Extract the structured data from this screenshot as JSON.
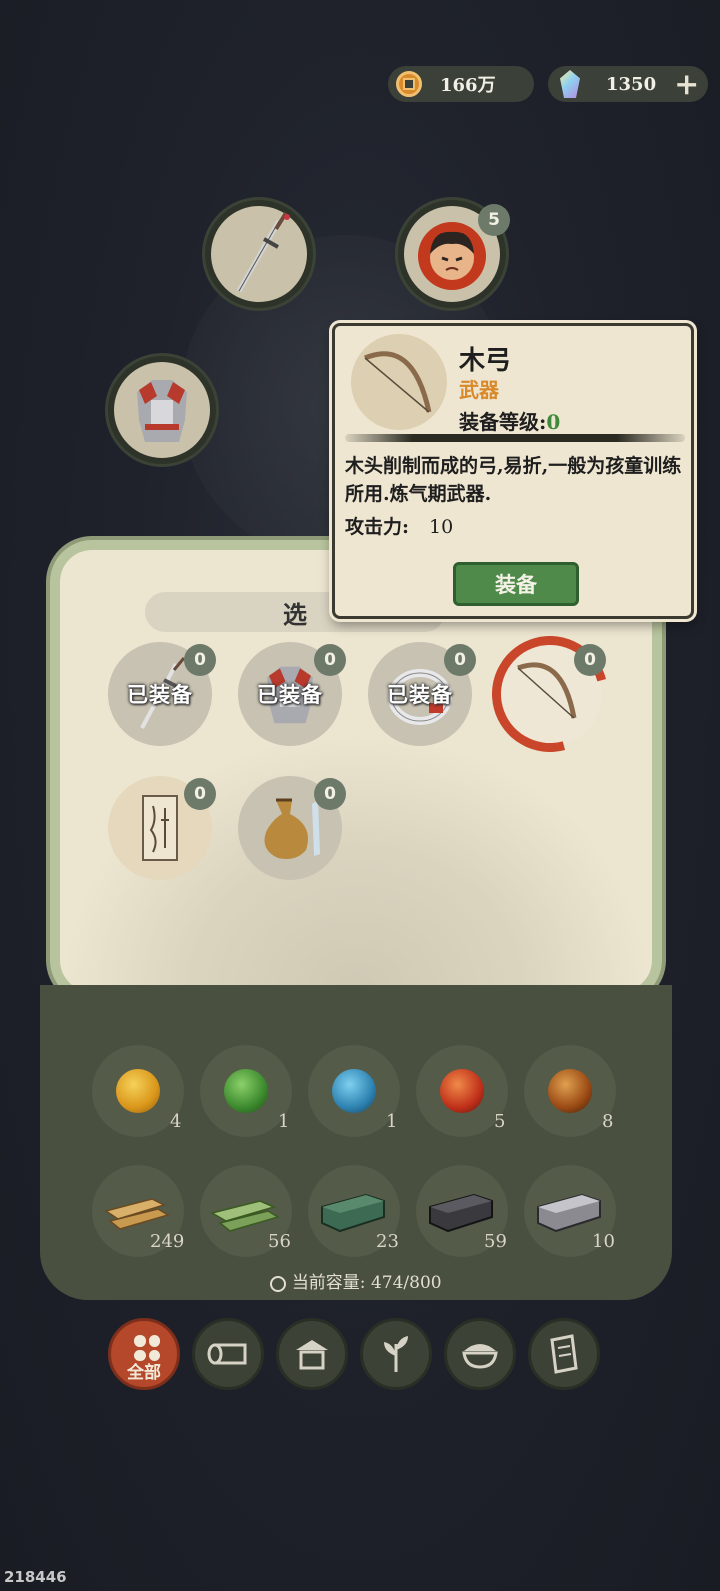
{
  "currency": {
    "coins": "166万",
    "gems": "1350",
    "add_label": "+"
  },
  "equip_slots": {
    "companion_badge": "5"
  },
  "inventory": {
    "title": "选",
    "equipped_label": "已装备",
    "items": [
      {
        "icon": "sword-icon",
        "badge": "0",
        "equipped": true
      },
      {
        "icon": "armor-icon",
        "badge": "0",
        "equipped": true
      },
      {
        "icon": "ring-icon",
        "badge": "0",
        "equipped": true
      },
      {
        "icon": "bow-icon",
        "badge": "0",
        "equipped": false,
        "selected": true
      },
      {
        "icon": "scroll-icon",
        "badge": "0",
        "equipped": false
      },
      {
        "icon": "gourd-icon",
        "badge": "0",
        "equipped": false
      }
    ]
  },
  "materials": {
    "orbs": [
      {
        "icon": "gold-orb-icon",
        "count": "4",
        "color": "#e0a020"
      },
      {
        "icon": "green-orb-icon",
        "count": "1",
        "color": "#4a9a3a"
      },
      {
        "icon": "blue-orb-icon",
        "count": "1",
        "color": "#3a90b8"
      },
      {
        "icon": "red-orb-icon",
        "count": "5",
        "color": "#c83a1e"
      },
      {
        "icon": "dark-orb-icon",
        "count": "8",
        "color": "#a0521a"
      }
    ],
    "resources": [
      {
        "icon": "plank-icon",
        "count": "249"
      },
      {
        "icon": "bamboo-icon",
        "count": "56"
      },
      {
        "icon": "jade-ingot-icon",
        "count": "23"
      },
      {
        "icon": "iron-ingot-icon",
        "count": "59"
      },
      {
        "icon": "silver-ingot-icon",
        "count": "10"
      }
    ],
    "capacity_label": "当前容量:",
    "capacity_value": "474/800"
  },
  "tabs": [
    {
      "icon": "grid-icon",
      "label": "全部",
      "active": true
    },
    {
      "icon": "log-icon",
      "label": "",
      "active": false
    },
    {
      "icon": "house-icon",
      "label": "",
      "active": false
    },
    {
      "icon": "herb-icon",
      "label": "",
      "active": false
    },
    {
      "icon": "bowl-icon",
      "label": "",
      "active": false
    },
    {
      "icon": "scroll-icon",
      "label": "",
      "active": false
    }
  ],
  "tooltip": {
    "name": "木弓",
    "type": "武器",
    "level_label": "装备等级:",
    "level_value": "0",
    "description": "木头削制而成的弓,易折,一般为孩童训练所用.炼气期武器.",
    "attack_label": "攻击力:",
    "attack_value": "10",
    "equip_button": "装备"
  },
  "footer_id": "218446",
  "colors": {
    "accent_red": "#c9462b",
    "button_green": "#4f8a4a",
    "type_orange": "#d8892a",
    "level_green": "#3e8a3a"
  }
}
